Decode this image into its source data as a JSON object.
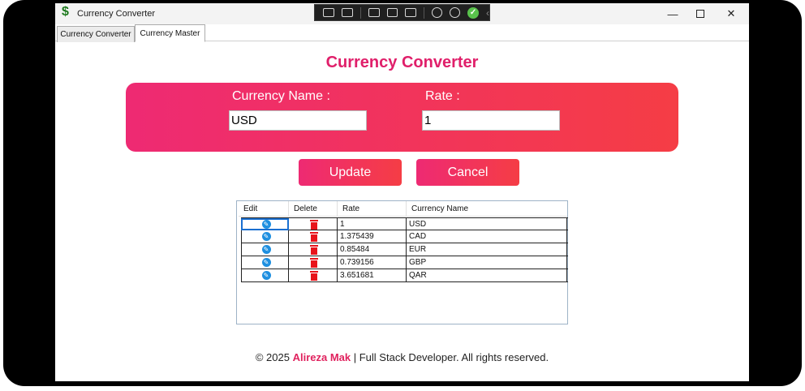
{
  "window": {
    "title": "Currency Converter",
    "icon": "dollar-icon",
    "icon_glyph": "$"
  },
  "tabs": [
    {
      "label": "Currency Converter",
      "active": false
    },
    {
      "label": "Currency Master",
      "active": true
    }
  ],
  "page": {
    "title": "Currency Converter",
    "currency_name_label": "Currency Name :",
    "currency_name_value": "USD",
    "rate_label": "Rate :",
    "rate_value": "1",
    "update_label": "Update",
    "cancel_label": "Cancel"
  },
  "grid": {
    "columns": [
      "Edit",
      "Delete",
      "Rate",
      "Currency Name"
    ],
    "rows": [
      {
        "rate": "1",
        "currency": "USD",
        "selected": true
      },
      {
        "rate": "1.375439",
        "currency": "CAD"
      },
      {
        "rate": "0.85484",
        "currency": "EUR"
      },
      {
        "rate": "0.739156",
        "currency": "GBP"
      },
      {
        "rate": "3.651681",
        "currency": "QAR"
      }
    ]
  },
  "footer": {
    "prefix": "© 2025 ",
    "name": "Alireza Mak",
    "suffix": " | Full Stack Developer. All rights reserved."
  },
  "colors": {
    "accent": "#e01f6a",
    "gradient_start": "#ee2a73",
    "gradient_end": "#f53d45",
    "edit_icon": "#1e8fe0",
    "delete_icon": "#e8141b"
  }
}
